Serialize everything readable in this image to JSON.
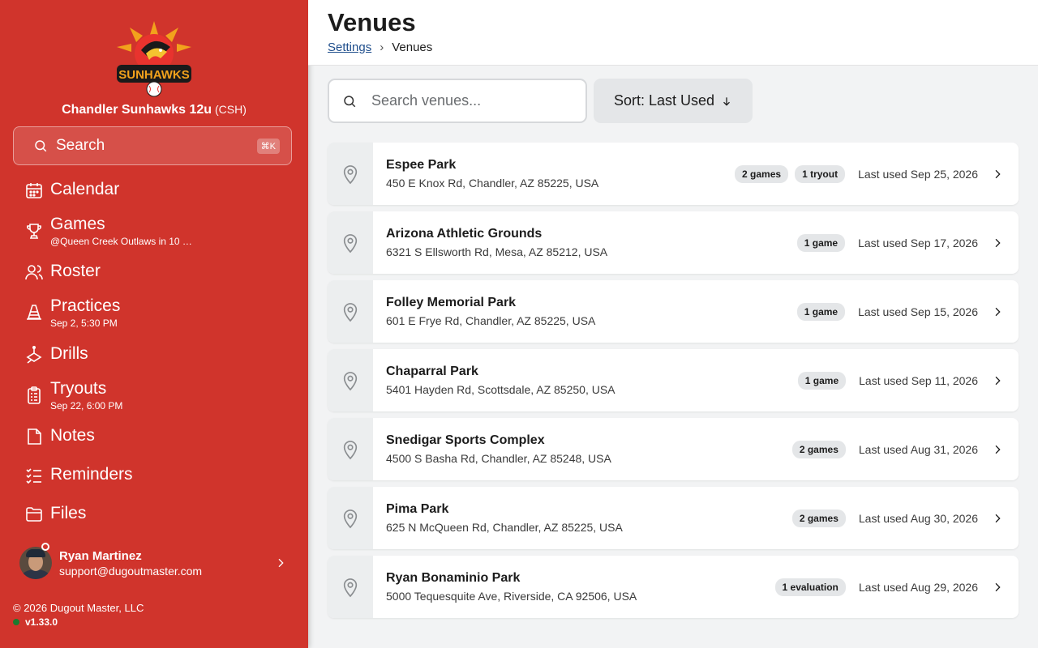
{
  "team": {
    "name": "Chandler Sunhawks 12u",
    "abbr": "(CSH)",
    "logo_text": "SUNHAWKS"
  },
  "sidebar": {
    "search_label": "Search",
    "search_shortcut": "⌘K",
    "nav": [
      {
        "id": "calendar",
        "label": "Calendar",
        "sub": "",
        "icon": "calendar-icon"
      },
      {
        "id": "games",
        "label": "Games",
        "sub": "@Queen Creek Outlaws in 10 …",
        "icon": "trophy-icon"
      },
      {
        "id": "roster",
        "label": "Roster",
        "sub": "",
        "icon": "users-icon"
      },
      {
        "id": "practices",
        "label": "Practices",
        "sub": "Sep 2, 5:30 PM",
        "icon": "cone-icon"
      },
      {
        "id": "drills",
        "label": "Drills",
        "sub": "",
        "icon": "drill-icon"
      },
      {
        "id": "tryouts",
        "label": "Tryouts",
        "sub": "Sep 22, 6:00 PM",
        "icon": "clipboard-icon"
      },
      {
        "id": "notes",
        "label": "Notes",
        "sub": "",
        "icon": "note-icon"
      },
      {
        "id": "reminders",
        "label": "Reminders",
        "sub": "",
        "icon": "checklist-icon"
      },
      {
        "id": "files",
        "label": "Files",
        "sub": "",
        "icon": "folder-icon"
      }
    ],
    "user": {
      "name": "Ryan Martinez",
      "email": "support@dugoutmaster.com"
    },
    "copyright": "© 2026 Dugout Master, LLC",
    "version": "v1.33.0"
  },
  "header": {
    "title": "Venues",
    "breadcrumb": {
      "link": "Settings",
      "sep": "›",
      "current": "Venues"
    }
  },
  "toolbar": {
    "search_placeholder": "Search venues...",
    "sort_label": "Sort: Last Used"
  },
  "venues": [
    {
      "name": "Espee Park",
      "address": "450 E Knox Rd, Chandler, AZ 85225, USA",
      "badges": [
        "2 games",
        "1 tryout"
      ],
      "last_used": "Last used Sep 25, 2026"
    },
    {
      "name": "Arizona Athletic Grounds",
      "address": "6321 S Ellsworth Rd, Mesa, AZ 85212, USA",
      "badges": [
        "1 game"
      ],
      "last_used": "Last used Sep 17, 2026"
    },
    {
      "name": "Folley Memorial Park",
      "address": "601 E Frye Rd, Chandler, AZ 85225, USA",
      "badges": [
        "1 game"
      ],
      "last_used": "Last used Sep 15, 2026"
    },
    {
      "name": "Chaparral Park",
      "address": "5401 Hayden Rd, Scottsdale, AZ 85250, USA",
      "badges": [
        "1 game"
      ],
      "last_used": "Last used Sep 11, 2026"
    },
    {
      "name": "Snedigar Sports Complex",
      "address": "4500 S Basha Rd, Chandler, AZ 85248, USA",
      "badges": [
        "2 games"
      ],
      "last_used": "Last used Aug 31, 2026"
    },
    {
      "name": "Pima Park",
      "address": "625 N McQueen Rd, Chandler, AZ 85225, USA",
      "badges": [
        "2 games"
      ],
      "last_used": "Last used Aug 30, 2026"
    },
    {
      "name": "Ryan Bonaminio Park",
      "address": "5000 Tequesquite Ave, Riverside, CA 92506, USA",
      "badges": [
        "1 evaluation"
      ],
      "last_used": "Last used Aug 29, 2026"
    }
  ],
  "colors": {
    "sidebar": "#d0342c",
    "accent_link": "#1f4e8c",
    "online": "#1d7a2f"
  }
}
